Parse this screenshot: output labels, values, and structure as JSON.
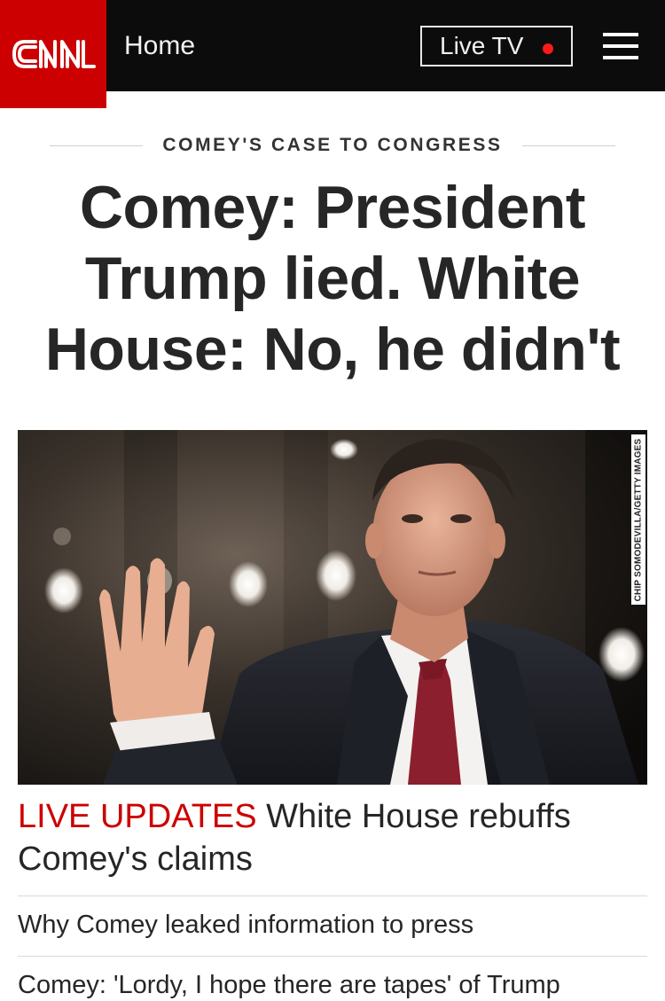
{
  "header": {
    "logo_text": "CNN",
    "home_label": "Home",
    "live_tv_label": "Live TV",
    "brand_color": "#cc0000"
  },
  "article": {
    "kicker": "COMEY'S CASE TO CONGRESS",
    "headline": "Comey: President Trump lied. White House: No, he didn't",
    "image_credit": "CHIP SOMODEVILLA/GETTY IMAGES"
  },
  "stories": {
    "lead_prefix": "LIVE UPDATES",
    "lead_text": "White House rebuffs Comey's claims",
    "items": [
      "Why Comey leaked information to press",
      "Comey: 'Lordy, I hope there are tapes' of Trump"
    ]
  },
  "icons": {
    "menu": "hamburger-menu-icon",
    "live": "live-dot-icon"
  }
}
